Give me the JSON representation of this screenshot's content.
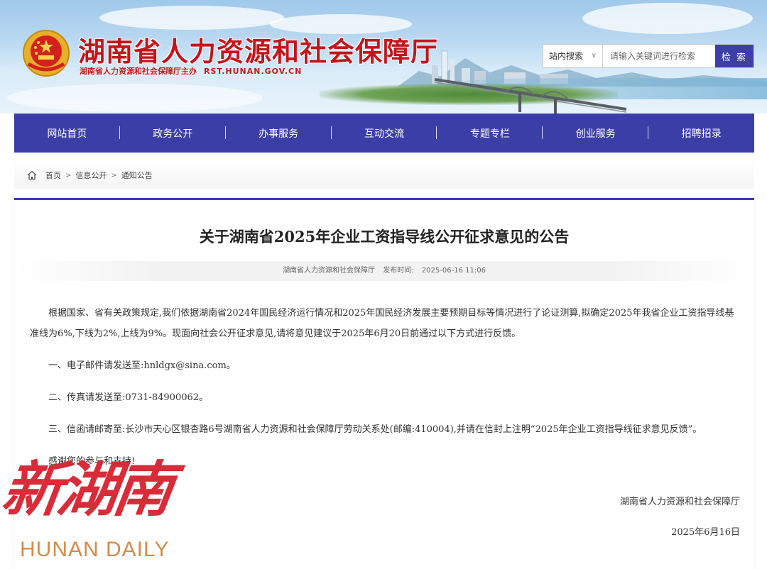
{
  "header": {
    "site_title": "湖南省人力资源和社会保障厅",
    "site_subtitle": "湖南省人力资源和社会保障厅主办",
    "site_domain": "RST.HUNAN.GOV.CN"
  },
  "search": {
    "scope_label": "站内搜索",
    "placeholder": "请输入关键词进行检索",
    "button_label": "检 索"
  },
  "nav": {
    "items": [
      "网站首页",
      "政务公开",
      "办事服务",
      "互动交流",
      "专题专栏",
      "创业服务",
      "招聘招录"
    ]
  },
  "breadcrumb": {
    "items": [
      "首页",
      "信息公开",
      "通知公告"
    ],
    "separator": ">"
  },
  "article": {
    "title": "关于湖南省2025年企业工资指导线公开征求意见的公告",
    "source": "湖南省人力资源和社会保障厅",
    "publish_label": "发布时间:",
    "publish_time": "2025-06-16 11:06",
    "paragraphs": [
      "根据国家、省有关政策规定,我们依据湖南省2024年国民经济运行情况和2025年国民经济发展主要预期目标等情况进行了论证测算,拟确定2025年我省企业工资指导线基准线为6%,下线为2%,上线为9%。现面向社会公开征求意见,请将意见建议于2025年6月20日前通过以下方式进行反馈。",
      "一、电子邮件请发送至:hnldgx@sina.com。",
      "二、传真请发送至:0731-84900062。",
      "三、信函请邮寄至:长沙市天心区银杏路6号湖南省人力资源和社会保障厅劳动关系处(邮编:410004),并请在信封上注明“2025年企业工资指导线征求意见反馈”。",
      "感谢您的参与和支持!"
    ],
    "signature": "湖南省人力资源和社会保障厅",
    "date": "2025年6月16日"
  },
  "watermark": {
    "logo_cn": "新湖南",
    "logo_en": "HUNAN DAILY"
  },
  "colors": {
    "brand_red": "#c4151c",
    "nav_blue": "#3c3ea8",
    "watermark_red": "#d7202e",
    "watermark_gold": "#d48b4a"
  },
  "icons": {
    "emblem": "national-emblem-icon",
    "home": "home-icon",
    "dropdown": "chevron-down-icon"
  }
}
